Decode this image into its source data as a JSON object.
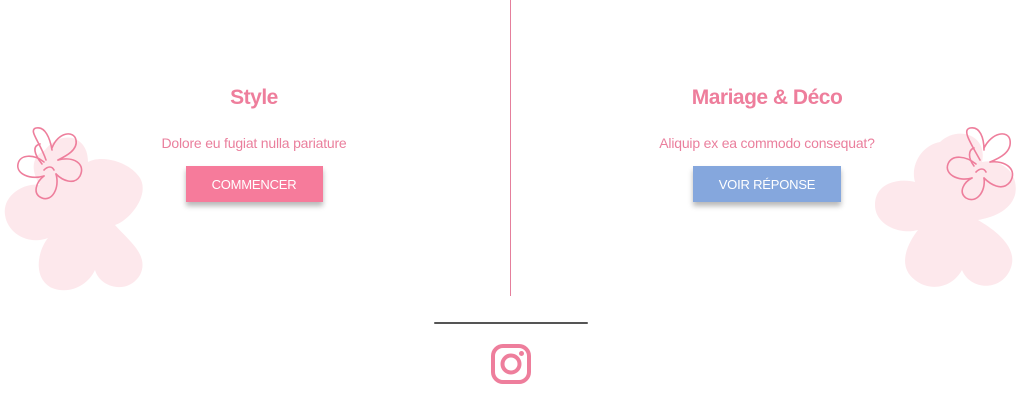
{
  "colors": {
    "accent_pink": "#ee7e9c",
    "button_pink": "#f67b9b",
    "button_blue": "#85a7dd",
    "flower_fill": "#fde8ec"
  },
  "left": {
    "title": "Style",
    "text": "Dolore eu fugiat nulla pariature",
    "button_label": "COMMENCER"
  },
  "right": {
    "title": "Mariage & Déco",
    "text": "Aliquip ex ea commodo consequat?",
    "button_label": "VOIR RÉPONSE"
  },
  "footer": {
    "social_icon": "instagram-icon"
  }
}
